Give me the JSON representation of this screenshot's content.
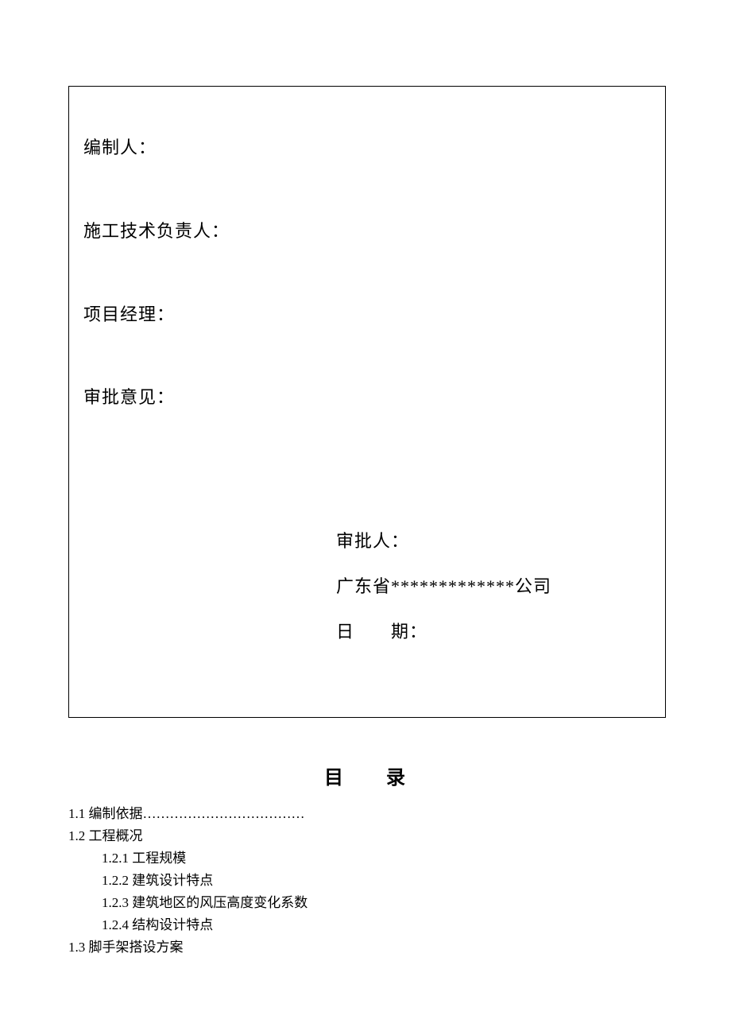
{
  "fields": {
    "compiler": "编制人：",
    "tech_lead": "施工技术负责人：",
    "project_manager": "项目经理：",
    "approval_opinion": "审批意见："
  },
  "approval": {
    "approver": "审批人：",
    "company": "广东省*************公司",
    "date_label": "日  期："
  },
  "toc": {
    "heading": "目  录",
    "item_1_1": "1.1  编制依据………………………………",
    "item_1_2": "1.2  工程概况",
    "item_1_2_1": "1.2.1 工程规模",
    "item_1_2_2": "1.2.2 建筑设计特点",
    "item_1_2_3": "1.2.3 建筑地区的风压高度变化系数",
    "item_1_2_4": "1.2.4 结构设计特点",
    "item_1_3": "1.3  脚手架搭设方案"
  }
}
